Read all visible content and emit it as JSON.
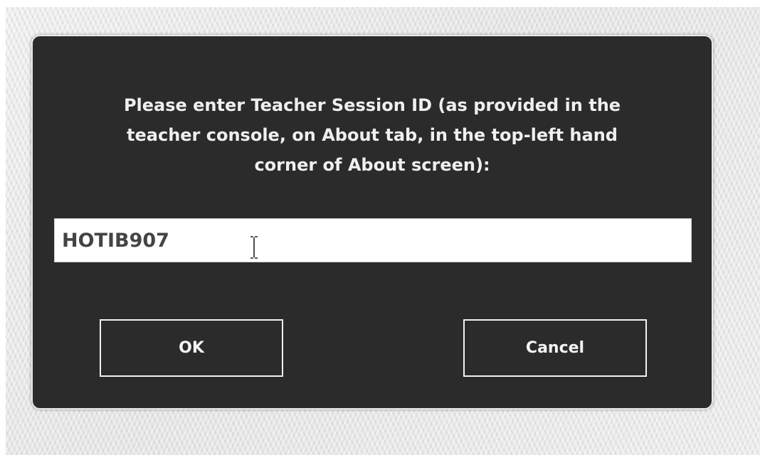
{
  "dialog": {
    "prompt_lines": [
      "Please enter Teacher Session ID (as provided in the",
      "teacher console, on About tab, in the top-left hand",
      "corner of About screen):"
    ],
    "session_id_value": "HOTIB907",
    "ok_label": "OK",
    "cancel_label": "Cancel",
    "text_cursor_icon": "i-beam-cursor-icon"
  },
  "colors": {
    "dialog_background": "#2b2b2b",
    "dialog_border": "#e9e9e9",
    "text": "#efefef",
    "input_background": "#ffffff",
    "input_text": "#444444"
  }
}
